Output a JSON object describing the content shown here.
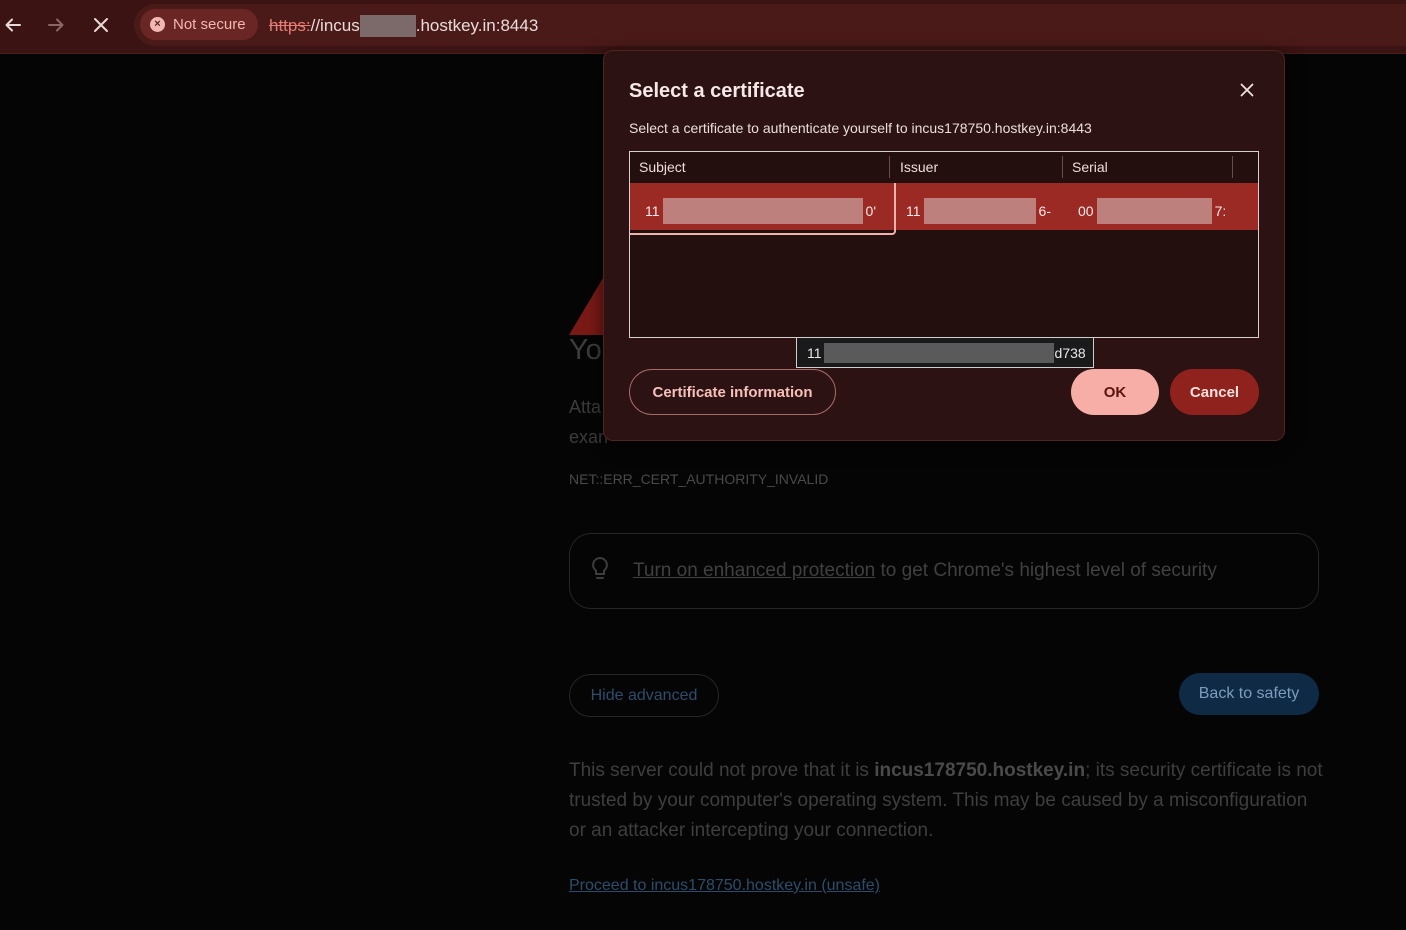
{
  "browser": {
    "security_chip": "Not secure",
    "url_scheme": "https:",
    "url_host_prefix": "//incus",
    "url_host_suffix": ".hostkey.in:8443"
  },
  "page": {
    "heading_fragment": "Yo",
    "text_fragment_1": "Atta",
    "text_fragment_2": "exan",
    "error_code": "NET::ERR_CERT_AUTHORITY_INVALID",
    "protection_link": "Turn on enhanced protection",
    "protection_text": " to get Chrome's highest level of security",
    "hide_advanced": "Hide advanced",
    "back_to_safety": "Back to safety",
    "explain_pre": "This server could not prove that it is ",
    "explain_host": "incus178750.hostkey.in",
    "explain_post": "; its security certificate is not trusted by your computer's operating system. This may be caused by a misconfiguration or an attacker intercepting your connection.",
    "proceed_link": "Proceed to incus178750.hostkey.in (unsafe)"
  },
  "dialog": {
    "title": "Select a certificate",
    "subtitle": "Select a certificate to authenticate yourself to incus178750.hostkey.in:8443",
    "columns": [
      "Subject",
      "Issuer",
      "Serial"
    ],
    "row": {
      "subject_start": "11",
      "subject_end": "0'",
      "issuer_start": "11",
      "issuer_end": "6-",
      "serial_start": "00",
      "serial_end": "7:"
    },
    "tooltip_start": "11",
    "tooltip_end": "d738",
    "cert_info_button": "Certificate information",
    "ok_button": "OK",
    "cancel_button": "Cancel"
  },
  "colors": {
    "toolbar": "#3a1312",
    "dialog": "#2c1212",
    "selected_row": "#9b2a25",
    "ok_button": "#f7aea6",
    "cancel_button": "#8f221d"
  }
}
